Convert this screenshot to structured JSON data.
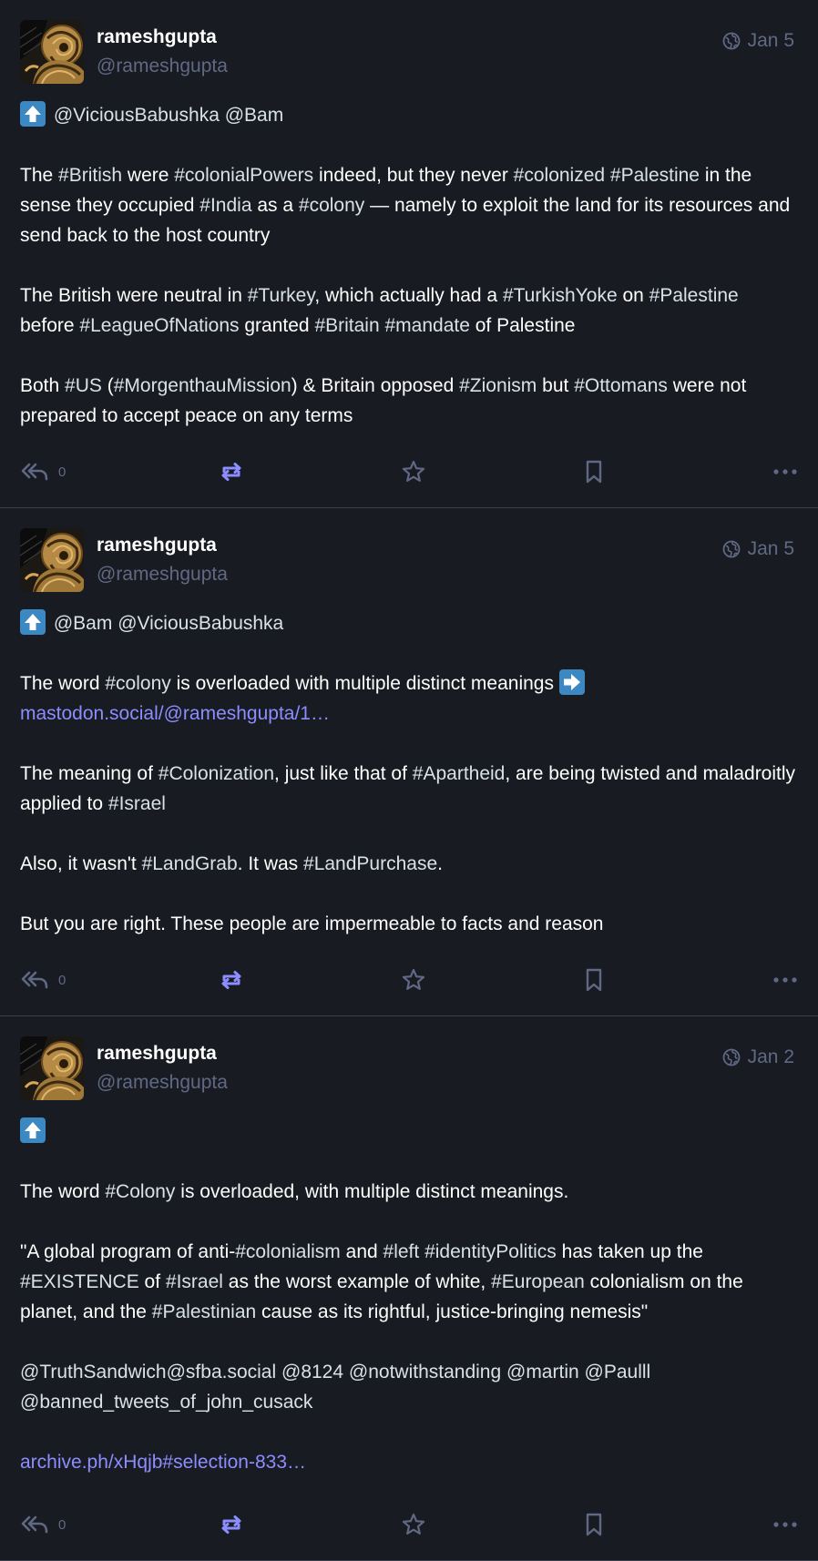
{
  "colors": {
    "background": "#191b22",
    "text": "#ffffff",
    "muted": "#606984",
    "hashtag": "#d9e1e8",
    "link": "#8c8dff",
    "boost_active": "#8c8dff",
    "emoji_blue": "#3b88c3",
    "divider": "#393f4f"
  },
  "icons": {
    "visibility": "globe-icon",
    "reply": "reply-all-icon",
    "boost": "boost-icon",
    "favourite": "star-icon",
    "bookmark": "bookmark-icon",
    "more": "more-icon",
    "emoji_up": "up-arrow-emoji",
    "emoji_right": "right-arrow-emoji"
  },
  "statuses": [
    {
      "display_name": "rameshgupta",
      "acct": "@rameshgupta",
      "date": "Jan 5",
      "reply_count": "0",
      "paragraphs": [
        [
          {
            "t": "emoji",
            "v": "up"
          },
          {
            "t": "text",
            "v": " "
          },
          {
            "t": "mention",
            "v": "@ViciousBabushka"
          },
          {
            "t": "text",
            "v": " "
          },
          {
            "t": "mention",
            "v": "@Bam"
          }
        ],
        [
          {
            "t": "text",
            "v": "The "
          },
          {
            "t": "hashtag",
            "v": "#British"
          },
          {
            "t": "text",
            "v": " were "
          },
          {
            "t": "hashtag",
            "v": "#colonialPowers"
          },
          {
            "t": "text",
            "v": " indeed, but they never "
          },
          {
            "t": "hashtag",
            "v": "#colonized"
          },
          {
            "t": "text",
            "v": " "
          },
          {
            "t": "hashtag",
            "v": "#Palestine"
          },
          {
            "t": "text",
            "v": " in the sense they occupied "
          },
          {
            "t": "hashtag",
            "v": "#India"
          },
          {
            "t": "text",
            "v": " as a "
          },
          {
            "t": "hashtag",
            "v": "#colony"
          },
          {
            "t": "text",
            "v": " — namely to exploit the land for its resources and send back to the host country"
          }
        ],
        [
          {
            "t": "text",
            "v": "The British were neutral in "
          },
          {
            "t": "hashtag",
            "v": "#Turkey"
          },
          {
            "t": "text",
            "v": ", which actually had a "
          },
          {
            "t": "hashtag",
            "v": "#TurkishYoke"
          },
          {
            "t": "text",
            "v": " on "
          },
          {
            "t": "hashtag",
            "v": "#Palestine"
          },
          {
            "t": "text",
            "v": " before "
          },
          {
            "t": "hashtag",
            "v": "#LeagueOfNations"
          },
          {
            "t": "text",
            "v": " granted "
          },
          {
            "t": "hashtag",
            "v": "#Britain"
          },
          {
            "t": "text",
            "v": " "
          },
          {
            "t": "hashtag",
            "v": "#mandate"
          },
          {
            "t": "text",
            "v": " of Palestine"
          }
        ],
        [
          {
            "t": "text",
            "v": "Both "
          },
          {
            "t": "hashtag",
            "v": "#US"
          },
          {
            "t": "text",
            "v": " ("
          },
          {
            "t": "hashtag",
            "v": "#MorgenthauMission"
          },
          {
            "t": "text",
            "v": ") & Britain opposed "
          },
          {
            "t": "hashtag",
            "v": "#Zionism"
          },
          {
            "t": "text",
            "v": " but "
          },
          {
            "t": "hashtag",
            "v": "#Ottomans"
          },
          {
            "t": "text",
            "v": " were not prepared to accept peace on any terms"
          }
        ]
      ]
    },
    {
      "display_name": "rameshgupta",
      "acct": "@rameshgupta",
      "date": "Jan 5",
      "reply_count": "0",
      "paragraphs": [
        [
          {
            "t": "emoji",
            "v": "up"
          },
          {
            "t": "text",
            "v": " "
          },
          {
            "t": "mention",
            "v": "@Bam"
          },
          {
            "t": "text",
            "v": " "
          },
          {
            "t": "mention",
            "v": "@ViciousBabushka"
          }
        ],
        [
          {
            "t": "text",
            "v": "The word "
          },
          {
            "t": "hashtag",
            "v": "#colony"
          },
          {
            "t": "text",
            "v": " is overloaded with multiple distinct meanings "
          },
          {
            "t": "emoji",
            "v": "right"
          },
          {
            "t": "break"
          },
          {
            "t": "link",
            "v": "mastodon.social/@rameshgupta/1…"
          }
        ],
        [
          {
            "t": "text",
            "v": "The meaning of "
          },
          {
            "t": "hashtag",
            "v": "#Colonization"
          },
          {
            "t": "text",
            "v": ", just like that of "
          },
          {
            "t": "hashtag",
            "v": "#Apartheid"
          },
          {
            "t": "text",
            "v": ", are being twisted and maladroitly applied to "
          },
          {
            "t": "hashtag",
            "v": "#Israel"
          }
        ],
        [
          {
            "t": "text",
            "v": "Also, it wasn't "
          },
          {
            "t": "hashtag",
            "v": "#LandGrab"
          },
          {
            "t": "text",
            "v": ". It was "
          },
          {
            "t": "hashtag",
            "v": "#LandPurchase"
          },
          {
            "t": "text",
            "v": "."
          }
        ],
        [
          {
            "t": "text",
            "v": "But you are right. These people are impermeable to facts and reason"
          }
        ]
      ]
    },
    {
      "display_name": "rameshgupta",
      "acct": "@rameshgupta",
      "date": "Jan 2",
      "reply_count": "0",
      "paragraphs": [
        [
          {
            "t": "emoji",
            "v": "up"
          }
        ],
        [
          {
            "t": "text",
            "v": "The word "
          },
          {
            "t": "hashtag",
            "v": "#Colony"
          },
          {
            "t": "text",
            "v": " is overloaded, with multiple distinct meanings."
          }
        ],
        [
          {
            "t": "text",
            "v": "\"A global program of anti-"
          },
          {
            "t": "hashtag",
            "v": "#colonialism"
          },
          {
            "t": "text",
            "v": " and "
          },
          {
            "t": "hashtag",
            "v": "#left"
          },
          {
            "t": "text",
            "v": " "
          },
          {
            "t": "hashtag",
            "v": "#identityPolitics"
          },
          {
            "t": "text",
            "v": " has taken up the "
          },
          {
            "t": "hashtag",
            "v": "#EXISTENCE"
          },
          {
            "t": "text",
            "v": " of "
          },
          {
            "t": "hashtag",
            "v": "#Israel"
          },
          {
            "t": "text",
            "v": " as the worst example of white, "
          },
          {
            "t": "hashtag",
            "v": "#European"
          },
          {
            "t": "text",
            "v": " colonialism on the planet, and the "
          },
          {
            "t": "hashtag",
            "v": "#Palestinian"
          },
          {
            "t": "text",
            "v": " cause as its rightful, justice-bringing nemesis\""
          }
        ],
        [
          {
            "t": "mention",
            "v": "@TruthSandwich@sfba.social"
          },
          {
            "t": "text",
            "v": " "
          },
          {
            "t": "mention",
            "v": "@8124"
          },
          {
            "t": "text",
            "v": " "
          },
          {
            "t": "mention",
            "v": "@notwithstanding"
          },
          {
            "t": "text",
            "v": " "
          },
          {
            "t": "mention",
            "v": "@martin"
          },
          {
            "t": "text",
            "v": " "
          },
          {
            "t": "mention",
            "v": "@Paulll"
          },
          {
            "t": "break"
          },
          {
            "t": "mention",
            "v": "@banned_tweets_of_john_cusack"
          }
        ],
        [
          {
            "t": "link",
            "v": "archive.ph/xHqjb#selection-833…"
          }
        ]
      ]
    }
  ]
}
